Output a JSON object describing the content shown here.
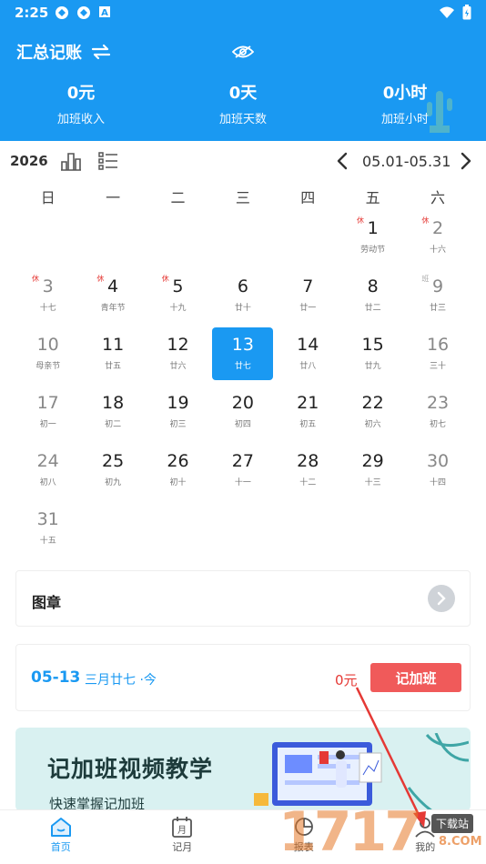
{
  "status_bar": {
    "time": "2:25"
  },
  "header": {
    "title": "汇总记账",
    "stats": [
      {
        "value": "0元",
        "label": "加班收入"
      },
      {
        "value": "0天",
        "label": "加班天数"
      },
      {
        "value": "0小时",
        "label": "加班小时"
      }
    ]
  },
  "toolbar": {
    "year": "2026",
    "date_range": "05.01-05.31"
  },
  "calendar": {
    "weekdays": [
      "日",
      "一",
      "二",
      "三",
      "四",
      "五",
      "六"
    ],
    "days": [
      {
        "day": "",
        "sub": ""
      },
      {
        "day": "",
        "sub": ""
      },
      {
        "day": "",
        "sub": ""
      },
      {
        "day": "",
        "sub": ""
      },
      {
        "day": "",
        "sub": ""
      },
      {
        "day": "1",
        "sub": "劳动节",
        "tag": "休"
      },
      {
        "day": "2",
        "sub": "十六",
        "tag": "休"
      },
      {
        "day": "3",
        "sub": "十七",
        "tag": "休"
      },
      {
        "day": "4",
        "sub": "青年节",
        "tag": "休"
      },
      {
        "day": "5",
        "sub": "十九",
        "tag": "休"
      },
      {
        "day": "6",
        "sub": "廿十"
      },
      {
        "day": "7",
        "sub": "廿一"
      },
      {
        "day": "8",
        "sub": "廿二"
      },
      {
        "day": "9",
        "sub": "廿三",
        "tag": "班"
      },
      {
        "day": "10",
        "sub": "母亲节"
      },
      {
        "day": "11",
        "sub": "廿五"
      },
      {
        "day": "12",
        "sub": "廿六"
      },
      {
        "day": "13",
        "sub": "廿七",
        "today": true
      },
      {
        "day": "14",
        "sub": "廿八"
      },
      {
        "day": "15",
        "sub": "廿九"
      },
      {
        "day": "16",
        "sub": "三十"
      },
      {
        "day": "17",
        "sub": "初一"
      },
      {
        "day": "18",
        "sub": "初二"
      },
      {
        "day": "19",
        "sub": "初三"
      },
      {
        "day": "20",
        "sub": "初四"
      },
      {
        "day": "21",
        "sub": "初五"
      },
      {
        "day": "22",
        "sub": "初六"
      },
      {
        "day": "23",
        "sub": "初七"
      },
      {
        "day": "24",
        "sub": "初八"
      },
      {
        "day": "25",
        "sub": "初九"
      },
      {
        "day": "26",
        "sub": "初十"
      },
      {
        "day": "27",
        "sub": "十一"
      },
      {
        "day": "28",
        "sub": "十二"
      },
      {
        "day": "29",
        "sub": "十三"
      },
      {
        "day": "30",
        "sub": "十四"
      },
      {
        "day": "31",
        "sub": "十五"
      }
    ]
  },
  "stamp_card": {
    "label": "图章"
  },
  "day_card": {
    "date": "05-13",
    "lunar": "三月廿七 ·今",
    "amount": "0元",
    "button": "记加班"
  },
  "banner": {
    "title": "记加班视频教学",
    "subtitle": "快速掌握记加班"
  },
  "bottom_nav": [
    {
      "label": "首页",
      "icon": "home-icon",
      "active": true
    },
    {
      "label": "记月",
      "icon": "calendar-icon"
    },
    {
      "label": "报表",
      "icon": "report-icon"
    },
    {
      "label": "我的",
      "icon": "profile-icon"
    }
  ],
  "watermark": {
    "digits": "1717",
    "badge": "下载站",
    "suffix": "8.COM"
  },
  "colors": {
    "primary": "#1a99f2",
    "accent_red": "#f05a5a",
    "holiday_red": "#e53935"
  }
}
